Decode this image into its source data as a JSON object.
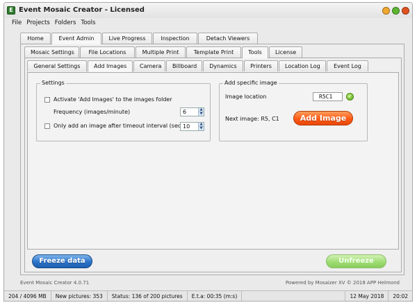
{
  "window": {
    "title": "Event Mosaic Creator - Licensed",
    "icon_letter": "E",
    "buttons": [
      {
        "name": "minimize",
        "color": "#f0a830"
      },
      {
        "name": "maximize",
        "color": "#5cb531"
      },
      {
        "name": "close",
        "color": "#e0521f"
      }
    ]
  },
  "menu": [
    "File",
    "Projects",
    "Folders",
    "Tools"
  ],
  "tabs_main": [
    "Home",
    "Event Admin",
    "Live Progress",
    "Inspection",
    "Detach Viewers"
  ],
  "tabs_admin": [
    "Mosaic Settings",
    "File Locations",
    "Multiple Print",
    "Template Print",
    "Tools",
    "License"
  ],
  "tabs_tools": [
    "General Settings",
    "Add Images",
    "Camera",
    "Billboard",
    "Dynamics",
    "Printers",
    "Location Log",
    "Event Log"
  ],
  "settings": {
    "group_title": "Settings",
    "activate_label": "Activate 'Add Images' to the images folder",
    "frequency_label": "Frequency (images/minute)",
    "frequency_value": "6",
    "timeout_label": "Only add an image after timeout interval (sec)",
    "timeout_value": "10"
  },
  "add_specific": {
    "group_title": "Add specific image",
    "location_label": "Image location",
    "location_value": "R5C1",
    "next_image": "Next image: R5, C1",
    "add_button": "Add Image"
  },
  "buttons": {
    "freeze": "Freeze data",
    "unfreeze": "Unfreeze"
  },
  "footer": {
    "version": "Event Mosaic Creator 4.0.71",
    "powered": "Powered by Mosaizer XV © 2018  APP Helmond"
  },
  "status": {
    "memory": "204 / 4096 MB",
    "new_pictures": "New pictures: 353",
    "status": "Status: 136 of 200 pictures",
    "eta": "E.t.a: 00:35 (m:s)",
    "date": "12 May 2018",
    "time": "20:02"
  }
}
